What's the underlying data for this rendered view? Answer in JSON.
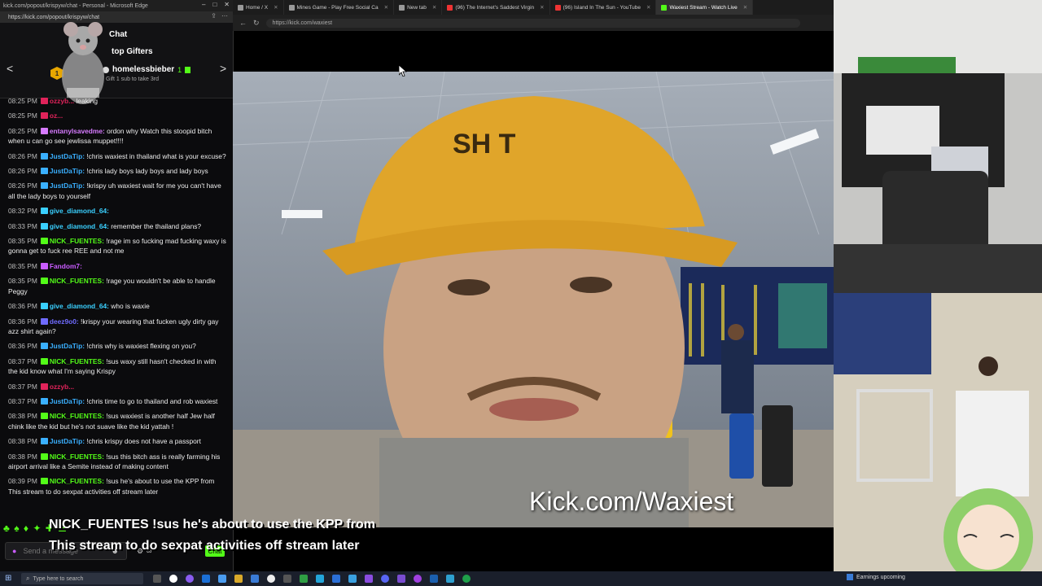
{
  "chat_window": {
    "title": "kick.com/popout/krispyw/chat - Personal - Microsoft Edge",
    "url": "https://kick.com/popout/krispyw/chat",
    "chat_title": "Chat",
    "top_gifters_label": "top Gifters",
    "gifter_name": "homelessbieber",
    "gifter_count": "1",
    "gift_line": "Gift 1 sub to take 3rd",
    "rank": "1",
    "input_placeholder": "Send a message",
    "chat_button": "Chat"
  },
  "messages": [
    {
      "time": "08:25 PM",
      "user": "ozzyb...",
      "color": "#e0235a",
      "text": "leaking"
    },
    {
      "time": "08:25 PM",
      "user": "oz...",
      "color": "#e0235a",
      "text": ""
    },
    {
      "time": "08:25 PM",
      "user": "entanylsavedme:",
      "color": "#d77bff",
      "text": "ordon why Watch this stoopid bitch when u can go see jewlissa muppet!!!!"
    },
    {
      "time": "08:26 PM",
      "user": "JustDaTip:",
      "color": "#3ab0ff",
      "text": "!chris waxiest in thailand what is your excuse?"
    },
    {
      "time": "08:26 PM",
      "user": "JustDaTip:",
      "color": "#3ab0ff",
      "text": "!chris lady boys lady boys and lady boys"
    },
    {
      "time": "08:26 PM",
      "user": "JustDaTip:",
      "color": "#3ab0ff",
      "text": "!krispy uh waxiest wait for me you can't have all the lady boys to yourself"
    },
    {
      "time": "08:32 PM",
      "user": "give_diamond_64:",
      "color": "#3ad0ff",
      "text": ""
    },
    {
      "time": "08:33 PM",
      "user": "give_diamond_64:",
      "color": "#3ad0ff",
      "text": "remember the thailand plans?"
    },
    {
      "time": "08:35 PM",
      "user": "NICK_FUENTES:",
      "color": "#53fc18",
      "text": "!rage im so fucking mad fucking waxy is gonna get to fuck ree REE and not me"
    },
    {
      "time": "08:35 PM",
      "user": "Fandom7:",
      "color": "#c95cff",
      "text": ""
    },
    {
      "time": "08:35 PM",
      "user": "NICK_FUENTES:",
      "color": "#53fc18",
      "text": "!rage you wouldn't be able to handle Peggy"
    },
    {
      "time": "08:36 PM",
      "user": "give_diamond_64:",
      "color": "#3ad0ff",
      "text": "who is waxie"
    },
    {
      "time": "08:36 PM",
      "user": "deez9o0:",
      "color": "#6f6bff",
      "text": "!krispy your wearing that fucken ugly dirty gay azz shirt again?"
    },
    {
      "time": "08:36 PM",
      "user": "JustDaTip:",
      "color": "#3ab0ff",
      "text": "!chris why is waxiest flexing on you?"
    },
    {
      "time": "08:37 PM",
      "user": "NICK_FUENTES:",
      "color": "#53fc18",
      "text": "!sus waxy still hasn't checked in with the kid know what I'm saying Krispy"
    },
    {
      "time": "08:37 PM",
      "user": "ozzyb...",
      "color": "#e0235a",
      "text": ""
    },
    {
      "time": "08:37 PM",
      "user": "JustDaTip:",
      "color": "#3ab0ff",
      "text": "!chris time to go to thailand and rob waxiest"
    },
    {
      "time": "08:38 PM",
      "user": "NICK_FUENTES:",
      "color": "#53fc18",
      "text": "!sus waxiest is another half Jew half chink like the kid but he's not suave like the kid yattah !"
    },
    {
      "time": "08:38 PM",
      "user": "JustDaTip:",
      "color": "#3ab0ff",
      "text": "!chris krispy does not have a passport"
    },
    {
      "time": "08:38 PM",
      "user": "NICK_FUENTES:",
      "color": "#53fc18",
      "text": "!sus this bitch ass is really farming his airport arrival like a Semite instead of making content"
    },
    {
      "time": "08:39 PM",
      "user": "NICK_FUENTES:",
      "color": "#53fc18",
      "text": "!sus he's about to use the KPP from This stream to do sexpat activities off stream later"
    }
  ],
  "tabs": [
    {
      "label": "Home / X",
      "icon": "x-icon"
    },
    {
      "label": "Mines Game - Play Free Social Ca",
      "icon": "game-icon"
    },
    {
      "label": "New tab",
      "icon": "newtab-icon"
    },
    {
      "label": "(96) The Internet's Saddest Virgin",
      "icon": "youtube-icon"
    },
    {
      "label": "(96) Island In The Sun - YouTube",
      "icon": "youtube-icon"
    },
    {
      "label": "Waxiest Stream - Watch Live",
      "icon": "kick-icon",
      "active": true
    }
  ],
  "address": "https://kick.com/waxiest",
  "watermark": "Kick.com/Waxiest",
  "overlay_caption": {
    "user": "NICK_FUENTES",
    "text": "!sus he's about to use the KPP from This stream to do sexpat activities off stream later"
  },
  "taskbar": {
    "search_placeholder": "Type here to search",
    "news": "Earnings upcoming"
  },
  "colors": {
    "kick_green": "#53fc18",
    "chat_bg": "#0b0b0d"
  }
}
